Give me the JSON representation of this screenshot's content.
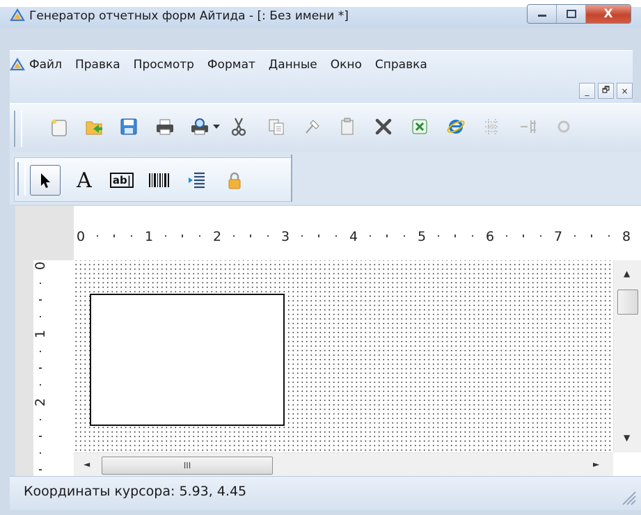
{
  "window": {
    "title": "Генератор отчетных форм Айтида - [: Без имени *]",
    "controls": {
      "minimize": "–",
      "maximize": "□",
      "close": "X"
    }
  },
  "menubar": {
    "items": [
      "Файл",
      "Правка",
      "Просмотр",
      "Формат",
      "Данные",
      "Окно",
      "Справка"
    ],
    "mdi_controls": {
      "minimize": "_",
      "restore": "🗗",
      "close": "×"
    }
  },
  "toolbar_main": {
    "icons": [
      "new-icon",
      "open-icon",
      "save-icon",
      "print-icon",
      "print-preview-icon",
      "dropdown-arrow-icon",
      "cut-icon",
      "copy-icon",
      "format-painter-icon",
      "paste-icon",
      "delete-icon",
      "export-excel-icon",
      "internet-explorer-icon",
      "insert-row-icon",
      "insert-column-icon",
      "more-icon"
    ]
  },
  "toolbar_tools": {
    "selected": "pointer",
    "items": [
      {
        "name": "pointer",
        "icon": "pointer-icon"
      },
      {
        "name": "text",
        "icon": "text-tool-icon",
        "glyph": "A"
      },
      {
        "name": "field",
        "icon": "field-tool-icon",
        "glyph": "ab|"
      },
      {
        "name": "barcode",
        "icon": "barcode-tool-icon"
      },
      {
        "name": "align",
        "icon": "align-tool-icon"
      },
      {
        "name": "lock",
        "icon": "lock-icon"
      }
    ]
  },
  "ruler": {
    "horizontal_labels": [
      "0",
      "1",
      "2",
      "3",
      "4",
      "5",
      "6",
      "7",
      "8"
    ],
    "vertical_labels": [
      "0",
      "1",
      "2"
    ]
  },
  "scrollbars": {
    "h_thumb_grip": "III",
    "left_arrow": "◄",
    "right_arrow": "►",
    "up_arrow": "▲",
    "down_arrow": "▼"
  },
  "statusbar": {
    "text": "Координаты курсора: 5.93, 4.45"
  },
  "colors": {
    "chrome": "#cfdbe9",
    "close_button": "#c6452e",
    "grid_dot": "#3a3a3a"
  }
}
